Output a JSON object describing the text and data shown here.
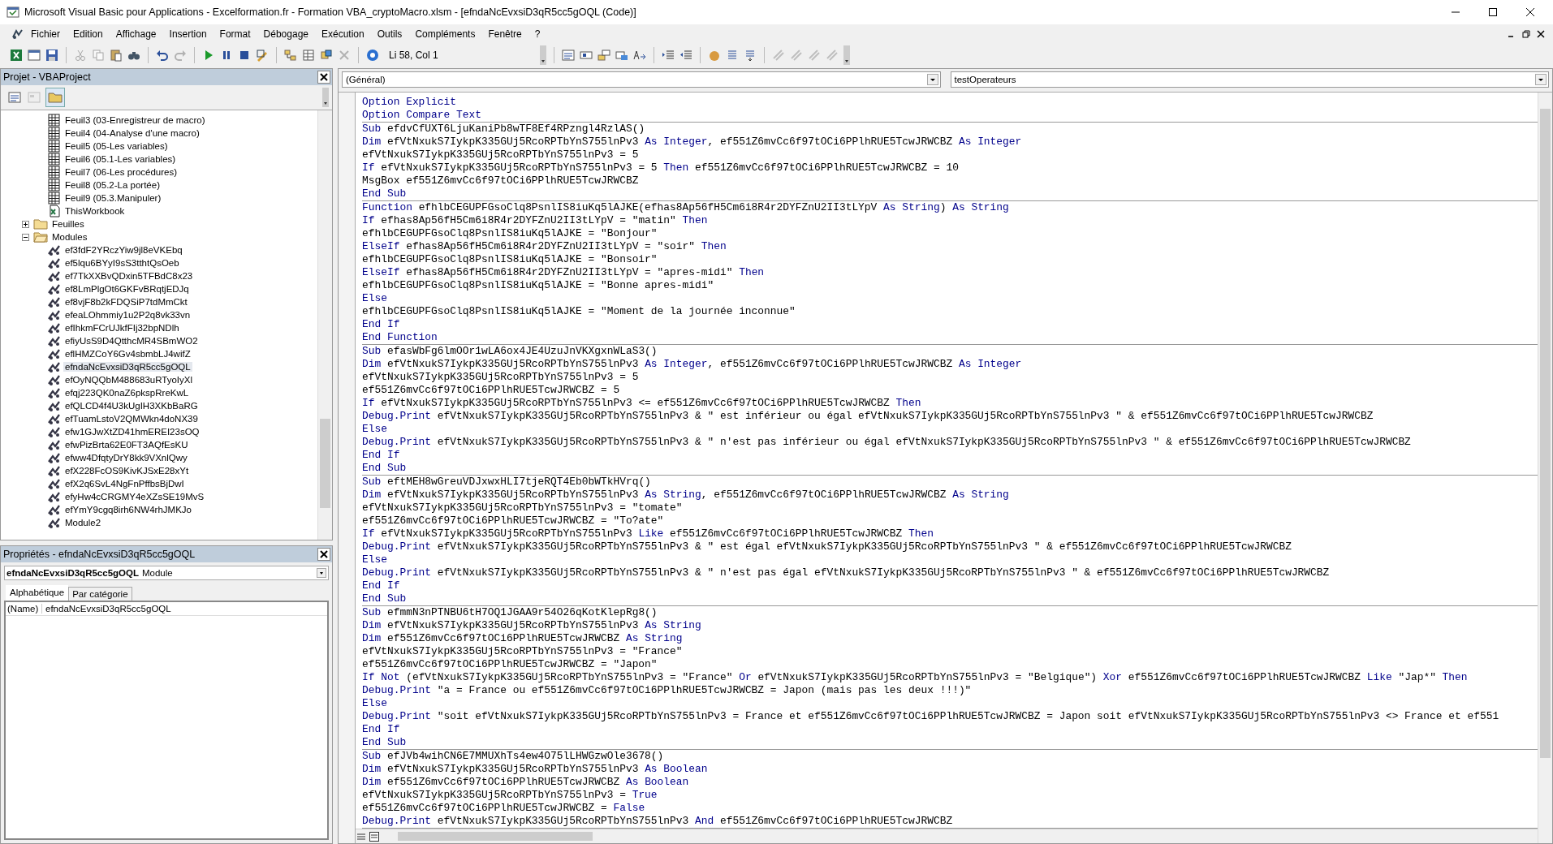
{
  "window": {
    "title": "Microsoft Visual Basic pour Applications - Excelformation.fr - Formation VBA_cryptoMacro.xlsm - [efndaNcEvxsiD3qR5cc5gOQL (Code)]"
  },
  "menu": [
    "Fichier",
    "Edition",
    "Affichage",
    "Insertion",
    "Format",
    "Débogage",
    "Exécution",
    "Outils",
    "Compléments",
    "Fenêtre",
    "?"
  ],
  "toolbar": {
    "position": "Li 58, Col 1"
  },
  "project": {
    "title": "Projet - VBAProject",
    "tree": [
      {
        "kind": "sheet",
        "label": "Feuil3 (03-Enregistreur de macro)",
        "selected": false
      },
      {
        "kind": "sheet",
        "label": "Feuil4 (04-Analyse d'une macro)",
        "selected": false
      },
      {
        "kind": "sheet",
        "label": "Feuil5 (05-Les variables)",
        "selected": false
      },
      {
        "kind": "sheet",
        "label": "Feuil6 (05.1-Les variables)",
        "selected": false
      },
      {
        "kind": "sheet",
        "label": "Feuil7 (06-Les procédures)",
        "selected": false
      },
      {
        "kind": "sheet",
        "label": "Feuil8 (05.2-La portée)",
        "selected": false
      },
      {
        "kind": "sheet",
        "label": "Feuil9 (05.3.Manipuler)",
        "selected": false
      },
      {
        "kind": "workbook",
        "label": "ThisWorkbook",
        "selected": false
      },
      {
        "kind": "folder",
        "label": "Feuilles",
        "expanded": false,
        "selected": false
      },
      {
        "kind": "folder",
        "label": "Modules",
        "expanded": true,
        "selected": false,
        "children": [
          {
            "kind": "module",
            "label": "ef3fdF2YRczYiw9jl8eVKEbq",
            "selected": false
          },
          {
            "kind": "module",
            "label": "ef5lqu6BYyI9sS3tthtQsOeb",
            "selected": false
          },
          {
            "kind": "module",
            "label": "ef7TkXXBvQDxin5TFBdC8x23",
            "selected": false
          },
          {
            "kind": "module",
            "label": "ef8LmPlgOt6GKFvBRqtjEDJq",
            "selected": false
          },
          {
            "kind": "module",
            "label": "ef8vjF8b2kFDQSiP7tdMmCkt",
            "selected": false
          },
          {
            "kind": "module",
            "label": "efeaLOhmmiy1u2P2q8vk33vn",
            "selected": false
          },
          {
            "kind": "module",
            "label": "efIhkmFCrUJkfFIj32bpNDlh",
            "selected": false
          },
          {
            "kind": "module",
            "label": "efiyUsS9D4QtthcMR4SBmWO2",
            "selected": false
          },
          {
            "kind": "module",
            "label": "eflHMZCoY6Gv4sbmbLJ4wifZ",
            "selected": false
          },
          {
            "kind": "module",
            "label": "efndaNcEvxsiD3qR5cc5gOQL",
            "selected": true
          },
          {
            "kind": "module",
            "label": "efOyNQQbM488683uRTyoIyXl",
            "selected": false
          },
          {
            "kind": "module",
            "label": "efqj223QK0naZ6pkspRreKwL",
            "selected": false
          },
          {
            "kind": "module",
            "label": "efQLCD4f4U3kUgIH3XKbBaRG",
            "selected": false
          },
          {
            "kind": "module",
            "label": "efTuamLstoV2QMWkn4doNX39",
            "selected": false
          },
          {
            "kind": "module",
            "label": "efw1GJwXtZD41hmEREI23sOQ",
            "selected": false
          },
          {
            "kind": "module",
            "label": "efwPizBrta62E0FT3AQfEsKU",
            "selected": false
          },
          {
            "kind": "module",
            "label": "efww4DfqtyDrY8kk9VXnlQwy",
            "selected": false
          },
          {
            "kind": "module",
            "label": "efX228FcOS9KivKJSxE28xYt",
            "selected": false
          },
          {
            "kind": "module",
            "label": "efX2q6SvL4NgFnPffbsBjDwI",
            "selected": false
          },
          {
            "kind": "module",
            "label": "efyHw4cCRGMY4eXZsSE19MvS",
            "selected": false
          },
          {
            "kind": "module",
            "label": "efYmY9cgq8irh6NW4rhJMKJo",
            "selected": false
          },
          {
            "kind": "module",
            "label": "Module2",
            "selected": false
          }
        ]
      }
    ]
  },
  "properties": {
    "title": "Propriétés - efndaNcEvxsiD3qR5cc5gOQL",
    "object": {
      "name": "efndaNcEvxsiD3qR5cc5gOQL",
      "type": "Module"
    },
    "tabs": [
      {
        "label": "Alphabétique",
        "selected": true
      },
      {
        "label": "Par catégorie",
        "selected": false
      }
    ],
    "rows": [
      {
        "name": "(Name)",
        "value": "efndaNcEvxsiD3qR5cc5gOQL"
      }
    ]
  },
  "editor": {
    "object": "(Général)",
    "procedure": "testOperateurs",
    "procedures": [
      {
        "lines": [
          {
            "tokens": [
              {
                "kind": "keyword",
                "text": "Option Explicit"
              }
            ]
          },
          {
            "tokens": [
              {
                "kind": "keyword",
                "text": "Option Compare Text"
              }
            ]
          }
        ]
      },
      {
        "lines": [
          {
            "tokens": [
              {
                "kind": "keyword",
                "text": "Sub"
              },
              {
                "kind": "plain",
                "text": " efdvCfUXT6LjuKaniPb8wTF8Ef4RPzngl4RzlAS()"
              }
            ]
          },
          {
            "tokens": [
              {
                "kind": "keyword",
                "text": "Dim"
              },
              {
                "kind": "plain",
                "text": " efVtNxukS7IykpK335GUj5RcoRPTbYnS755lnPv3 "
              },
              {
                "kind": "keyword",
                "text": "As Integer"
              },
              {
                "kind": "plain",
                "text": ", ef551Z6mvCc6f97tOCi6PPlhRUE5TcwJRWCBZ "
              },
              {
                "kind": "keyword",
                "text": "As Integer"
              }
            ]
          },
          {
            "tokens": [
              {
                "kind": "plain",
                "text": "efVtNxukS7IykpK335GUj5RcoRPTbYnS755lnPv3 = 5"
              }
            ]
          },
          {
            "tokens": [
              {
                "kind": "keyword",
                "text": "If"
              },
              {
                "kind": "plain",
                "text": " efVtNxukS7IykpK335GUj5RcoRPTbYnS755lnPv3 = 5 "
              },
              {
                "kind": "keyword",
                "text": "Then"
              },
              {
                "kind": "plain",
                "text": " ef551Z6mvCc6f97tOCi6PPlhRUE5TcwJRWCBZ = 10"
              }
            ]
          },
          {
            "tokens": [
              {
                "kind": "plain",
                "text": "MsgBox ef551Z6mvCc6f97tOCi6PPlhRUE5TcwJRWCBZ"
              }
            ]
          },
          {
            "tokens": [
              {
                "kind": "keyword",
                "text": "End Sub"
              }
            ]
          }
        ]
      },
      {
        "lines": [
          {
            "tokens": [
              {
                "kind": "keyword",
                "text": "Function"
              },
              {
                "kind": "plain",
                "text": " efhlbCEGUPFGsoClq8PsnlIS8iuKq5lAJKE(efhas8Ap56fH5Cm6i8R4r2DYFZnU2II3tLYpV "
              },
              {
                "kind": "keyword",
                "text": "As String"
              },
              {
                "kind": "plain",
                "text": ") "
              },
              {
                "kind": "keyword",
                "text": "As String"
              }
            ]
          },
          {
            "tokens": [
              {
                "kind": "keyword",
                "text": "If"
              },
              {
                "kind": "plain",
                "text": " efhas8Ap56fH5Cm6i8R4r2DYFZnU2II3tLYpV = \"matin\" "
              },
              {
                "kind": "keyword",
                "text": "Then"
              }
            ]
          },
          {
            "tokens": [
              {
                "kind": "plain",
                "text": "efhlbCEGUPFGsoClq8PsnlIS8iuKq5lAJKE = \"Bonjour\""
              }
            ]
          },
          {
            "tokens": [
              {
                "kind": "keyword",
                "text": "ElseIf"
              },
              {
                "kind": "plain",
                "text": " efhas8Ap56fH5Cm6i8R4r2DYFZnU2II3tLYpV = \"soir\" "
              },
              {
                "kind": "keyword",
                "text": "Then"
              }
            ]
          },
          {
            "tokens": [
              {
                "kind": "plain",
                "text": "efhlbCEGUPFGsoClq8PsnlIS8iuKq5lAJKE = \"Bonsoir\""
              }
            ]
          },
          {
            "tokens": [
              {
                "kind": "keyword",
                "text": "ElseIf"
              },
              {
                "kind": "plain",
                "text": " efhas8Ap56fH5Cm6i8R4r2DYFZnU2II3tLYpV = \"apres-midi\" "
              },
              {
                "kind": "keyword",
                "text": "Then"
              }
            ]
          },
          {
            "tokens": [
              {
                "kind": "plain",
                "text": "efhlbCEGUPFGsoClq8PsnlIS8iuKq5lAJKE = \"Bonne apres-midi\""
              }
            ]
          },
          {
            "tokens": [
              {
                "kind": "keyword",
                "text": "Else"
              }
            ]
          },
          {
            "tokens": [
              {
                "kind": "plain",
                "text": "efhlbCEGUPFGsoClq8PsnlIS8iuKq5lAJKE = \"Moment de la journée inconnue\""
              }
            ]
          },
          {
            "tokens": [
              {
                "kind": "keyword",
                "text": "End If"
              }
            ]
          },
          {
            "tokens": [
              {
                "kind": "keyword",
                "text": "End Function"
              }
            ]
          }
        ]
      },
      {
        "lines": [
          {
            "tokens": [
              {
                "kind": "keyword",
                "text": "Sub"
              },
              {
                "kind": "plain",
                "text": " efasWbFg6lmOOr1wLA6ox4JE4UzuJnVKXgxnWLaS3()"
              }
            ]
          },
          {
            "tokens": [
              {
                "kind": "keyword",
                "text": "Dim"
              },
              {
                "kind": "plain",
                "text": " efVtNxukS7IykpK335GUj5RcoRPTbYnS755lnPv3 "
              },
              {
                "kind": "keyword",
                "text": "As Integer"
              },
              {
                "kind": "plain",
                "text": ", ef551Z6mvCc6f97tOCi6PPlhRUE5TcwJRWCBZ "
              },
              {
                "kind": "keyword",
                "text": "As Integer"
              }
            ]
          },
          {
            "tokens": [
              {
                "kind": "plain",
                "text": "efVtNxukS7IykpK335GUj5RcoRPTbYnS755lnPv3 = 5"
              }
            ]
          },
          {
            "tokens": [
              {
                "kind": "plain",
                "text": "ef551Z6mvCc6f97tOCi6PPlhRUE5TcwJRWCBZ = 5"
              }
            ]
          },
          {
            "tokens": [
              {
                "kind": "keyword",
                "text": "If"
              },
              {
                "kind": "plain",
                "text": " efVtNxukS7IykpK335GUj5RcoRPTbYnS755lnPv3 <= ef551Z6mvCc6f97tOCi6PPlhRUE5TcwJRWCBZ "
              },
              {
                "kind": "keyword",
                "text": "Then"
              }
            ]
          },
          {
            "tokens": [
              {
                "kind": "keyword",
                "text": "Debug.Print"
              },
              {
                "kind": "plain",
                "text": " efVtNxukS7IykpK335GUj5RcoRPTbYnS755lnPv3 & \" est inférieur ou égal efVtNxukS7IykpK335GUj5RcoRPTbYnS755lnPv3 \" & ef551Z6mvCc6f97tOCi6PPlhRUE5TcwJRWCBZ"
              }
            ]
          },
          {
            "tokens": [
              {
                "kind": "keyword",
                "text": "Else"
              }
            ]
          },
          {
            "tokens": [
              {
                "kind": "keyword",
                "text": "Debug.Print"
              },
              {
                "kind": "plain",
                "text": " efVtNxukS7IykpK335GUj5RcoRPTbYnS755lnPv3 & \" n'est pas inférieur ou égal efVtNxukS7IykpK335GUj5RcoRPTbYnS755lnPv3 \" & ef551Z6mvCc6f97tOCi6PPlhRUE5TcwJRWCBZ"
              }
            ]
          },
          {
            "tokens": [
              {
                "kind": "keyword",
                "text": "End If"
              }
            ]
          },
          {
            "tokens": [
              {
                "kind": "keyword",
                "text": "End Sub"
              }
            ]
          }
        ]
      },
      {
        "lines": [
          {
            "tokens": [
              {
                "kind": "keyword",
                "text": "Sub"
              },
              {
                "kind": "plain",
                "text": " eftMEH8wGreuVDJxwxHLI7tjeRQT4Eb0bWTkHVrq()"
              }
            ]
          },
          {
            "tokens": [
              {
                "kind": "keyword",
                "text": "Dim"
              },
              {
                "kind": "plain",
                "text": " efVtNxukS7IykpK335GUj5RcoRPTbYnS755lnPv3 "
              },
              {
                "kind": "keyword",
                "text": "As String"
              },
              {
                "kind": "plain",
                "text": ", ef551Z6mvCc6f97tOCi6PPlhRUE5TcwJRWCBZ "
              },
              {
                "kind": "keyword",
                "text": "As String"
              }
            ]
          },
          {
            "tokens": [
              {
                "kind": "plain",
                "text": "efVtNxukS7IykpK335GUj5RcoRPTbYnS755lnPv3 = \"tomate\""
              }
            ]
          },
          {
            "tokens": [
              {
                "kind": "plain",
                "text": "ef551Z6mvCc6f97tOCi6PPlhRUE5TcwJRWCBZ = \"To?ate\""
              }
            ]
          },
          {
            "tokens": [
              {
                "kind": "keyword",
                "text": "If"
              },
              {
                "kind": "plain",
                "text": " efVtNxukS7IykpK335GUj5RcoRPTbYnS755lnPv3 "
              },
              {
                "kind": "keyword",
                "text": "Like"
              },
              {
                "kind": "plain",
                "text": " ef551Z6mvCc6f97tOCi6PPlhRUE5TcwJRWCBZ "
              },
              {
                "kind": "keyword",
                "text": "Then"
              }
            ]
          },
          {
            "tokens": [
              {
                "kind": "keyword",
                "text": "Debug.Print"
              },
              {
                "kind": "plain",
                "text": " efVtNxukS7IykpK335GUj5RcoRPTbYnS755lnPv3 & \" est égal efVtNxukS7IykpK335GUj5RcoRPTbYnS755lnPv3 \" & ef551Z6mvCc6f97tOCi6PPlhRUE5TcwJRWCBZ"
              }
            ]
          },
          {
            "tokens": [
              {
                "kind": "keyword",
                "text": "Else"
              }
            ]
          },
          {
            "tokens": [
              {
                "kind": "keyword",
                "text": "Debug.Print"
              },
              {
                "kind": "plain",
                "text": " efVtNxukS7IykpK335GUj5RcoRPTbYnS755lnPv3 & \" n'est pas égal efVtNxukS7IykpK335GUj5RcoRPTbYnS755lnPv3 \" & ef551Z6mvCc6f97tOCi6PPlhRUE5TcwJRWCBZ"
              }
            ]
          },
          {
            "tokens": [
              {
                "kind": "keyword",
                "text": "End If"
              }
            ]
          },
          {
            "tokens": [
              {
                "kind": "keyword",
                "text": "End Sub"
              }
            ]
          }
        ]
      },
      {
        "lines": [
          {
            "tokens": [
              {
                "kind": "keyword",
                "text": "Sub"
              },
              {
                "kind": "plain",
                "text": " efmmN3nPTNBU6tH7OQ1JGAA9r54O26qKotKlepRg8()"
              }
            ]
          },
          {
            "tokens": [
              {
                "kind": "keyword",
                "text": "Dim"
              },
              {
                "kind": "plain",
                "text": " efVtNxukS7IykpK335GUj5RcoRPTbYnS755lnPv3 "
              },
              {
                "kind": "keyword",
                "text": "As String"
              }
            ]
          },
          {
            "tokens": [
              {
                "kind": "keyword",
                "text": "Dim"
              },
              {
                "kind": "plain",
                "text": " ef551Z6mvCc6f97tOCi6PPlhRUE5TcwJRWCBZ "
              },
              {
                "kind": "keyword",
                "text": "As String"
              }
            ]
          },
          {
            "tokens": [
              {
                "kind": "plain",
                "text": "efVtNxukS7IykpK335GUj5RcoRPTbYnS755lnPv3 = \"France\""
              }
            ]
          },
          {
            "tokens": [
              {
                "kind": "plain",
                "text": "ef551Z6mvCc6f97tOCi6PPlhRUE5TcwJRWCBZ = \"Japon\""
              }
            ]
          },
          {
            "tokens": [
              {
                "kind": "keyword",
                "text": "If Not"
              },
              {
                "kind": "plain",
                "text": " (efVtNxukS7IykpK335GUj5RcoRPTbYnS755lnPv3 = \"France\" "
              },
              {
                "kind": "keyword",
                "text": "Or"
              },
              {
                "kind": "plain",
                "text": " efVtNxukS7IykpK335GUj5RcoRPTbYnS755lnPv3 = \"Belgique\") "
              },
              {
                "kind": "keyword",
                "text": "Xor"
              },
              {
                "kind": "plain",
                "text": " ef551Z6mvCc6f97tOCi6PPlhRUE5TcwJRWCBZ "
              },
              {
                "kind": "keyword",
                "text": "Like"
              },
              {
                "kind": "plain",
                "text": " \"Jap*\" "
              },
              {
                "kind": "keyword",
                "text": "Then"
              }
            ]
          },
          {
            "tokens": [
              {
                "kind": "keyword",
                "text": "Debug.Print"
              },
              {
                "kind": "plain",
                "text": " \"a = France ou ef551Z6mvCc6f97tOCi6PPlhRUE5TcwJRWCBZ = Japon (mais pas les deux !!!)\""
              }
            ]
          },
          {
            "tokens": [
              {
                "kind": "keyword",
                "text": "Else"
              }
            ]
          },
          {
            "tokens": [
              {
                "kind": "keyword",
                "text": "Debug.Print"
              },
              {
                "kind": "plain",
                "text": " \"soit efVtNxukS7IykpK335GUj5RcoRPTbYnS755lnPv3 = France et ef551Z6mvCc6f97tOCi6PPlhRUE5TcwJRWCBZ = Japon soit efVtNxukS7IykpK335GUj5RcoRPTbYnS755lnPv3 <> France et ef551"
              }
            ]
          },
          {
            "tokens": [
              {
                "kind": "keyword",
                "text": "End If"
              }
            ]
          },
          {
            "tokens": [
              {
                "kind": "keyword",
                "text": "End Sub"
              }
            ]
          }
        ]
      },
      {
        "lines": [
          {
            "tokens": [
              {
                "kind": "keyword",
                "text": "Sub"
              },
              {
                "kind": "plain",
                "text": " efJVb4wihCN6E7MMUXhTs4ew4O75lLHWGzwOle3678()"
              }
            ]
          },
          {
            "tokens": [
              {
                "kind": "keyword",
                "text": "Dim"
              },
              {
                "kind": "plain",
                "text": " efVtNxukS7IykpK335GUj5RcoRPTbYnS755lnPv3 "
              },
              {
                "kind": "keyword",
                "text": "As Boolean"
              }
            ]
          },
          {
            "tokens": [
              {
                "kind": "keyword",
                "text": "Dim"
              },
              {
                "kind": "plain",
                "text": " ef551Z6mvCc6f97tOCi6PPlhRUE5TcwJRWCBZ "
              },
              {
                "kind": "keyword",
                "text": "As Boolean"
              }
            ]
          },
          {
            "tokens": [
              {
                "kind": "plain",
                "text": "efVtNxukS7IykpK335GUj5RcoRPTbYnS755lnPv3 = "
              },
              {
                "kind": "keyword",
                "text": "True"
              }
            ]
          },
          {
            "tokens": [
              {
                "kind": "plain",
                "text": "ef551Z6mvCc6f97tOCi6PPlhRUE5TcwJRWCBZ = "
              },
              {
                "kind": "keyword",
                "text": "False"
              }
            ]
          },
          {
            "tokens": [
              {
                "kind": "keyword",
                "text": "Debug.Print"
              },
              {
                "kind": "plain",
                "text": " efVtNxukS7IykpK335GUj5RcoRPTbYnS755lnPv3 "
              },
              {
                "kind": "keyword",
                "text": "And"
              },
              {
                "kind": "plain",
                "text": " ef551Z6mvCc6f97tOCi6PPlhRUE5TcwJRWCBZ"
              }
            ]
          }
        ]
      }
    ]
  }
}
